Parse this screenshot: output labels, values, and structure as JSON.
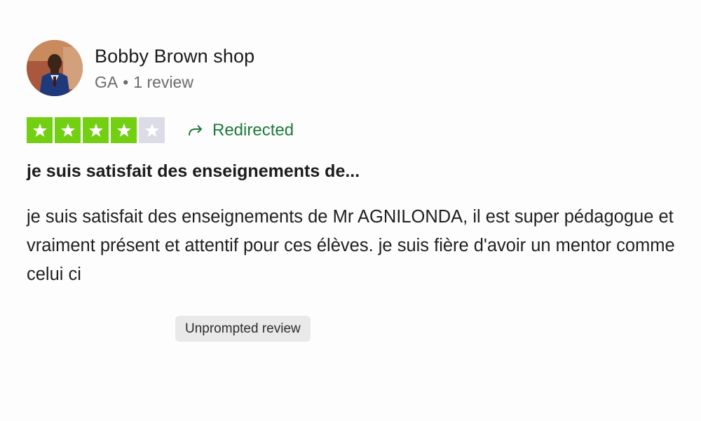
{
  "reviewer": {
    "name": "Bobby Brown shop",
    "country": "GA",
    "separator": "•",
    "review_count": "1 review"
  },
  "rating": {
    "stars": 4,
    "max_stars": 5,
    "filled_color": "#73cf11",
    "empty_color": "#dcdce6"
  },
  "status": {
    "icon": "redirect-arrow-icon",
    "label": "Redirected",
    "color": "#1d7a3a"
  },
  "review": {
    "title": "je suis satisfait des enseignements de...",
    "body": "je suis satisfait des enseignements de Mr AGNILONDA, il est super pédagogue et vraiment présent et attentif pour ces élèves. je suis fière d'avoir un mentor comme celui ci",
    "badge": "Unprompted review"
  }
}
